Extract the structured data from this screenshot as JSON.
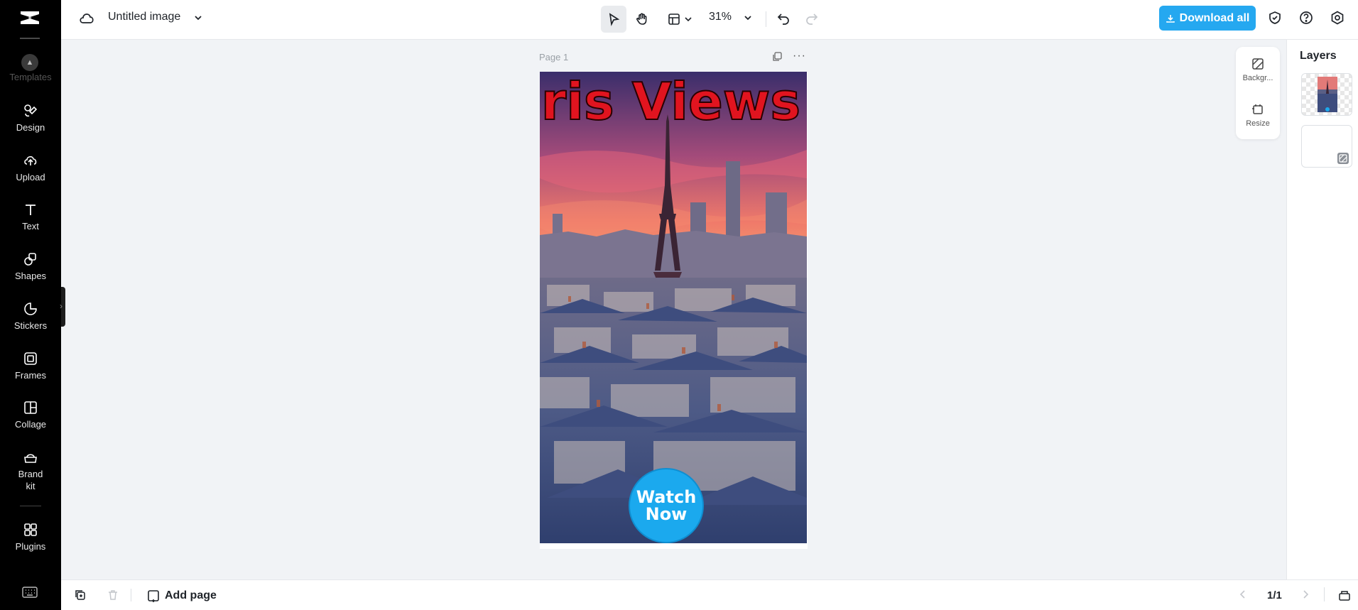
{
  "app": {
    "document_title": "Untitled image",
    "zoom_level": "31%",
    "download_label": "Download all",
    "accent_color": "#25a8f0"
  },
  "sidebar": {
    "top_label": "Templates",
    "items": [
      {
        "label": "Design",
        "icon": "design-icon"
      },
      {
        "label": "Upload",
        "icon": "upload-cloud-icon"
      },
      {
        "label": "Text",
        "icon": "text-icon"
      },
      {
        "label": "Shapes",
        "icon": "shapes-icon"
      },
      {
        "label": "Stickers",
        "icon": "sticker-icon"
      },
      {
        "label": "Frames",
        "icon": "frame-icon"
      },
      {
        "label": "Collage",
        "icon": "collage-icon"
      },
      {
        "label": "Brand\nkit",
        "icon": "brand-kit-icon"
      },
      {
        "label": "Plugins",
        "icon": "plugins-icon"
      }
    ]
  },
  "canvas": {
    "page_label": "Page 1",
    "artwork": {
      "headline": "aris Views!",
      "button_line1": "Watch",
      "button_line2": "Now"
    }
  },
  "float_tools": {
    "background_label": "Backgr...",
    "resize_label": "Resize"
  },
  "layers": {
    "title": "Layers"
  },
  "bottombar": {
    "add_page_label": "Add page",
    "page_counter": "1/1"
  }
}
